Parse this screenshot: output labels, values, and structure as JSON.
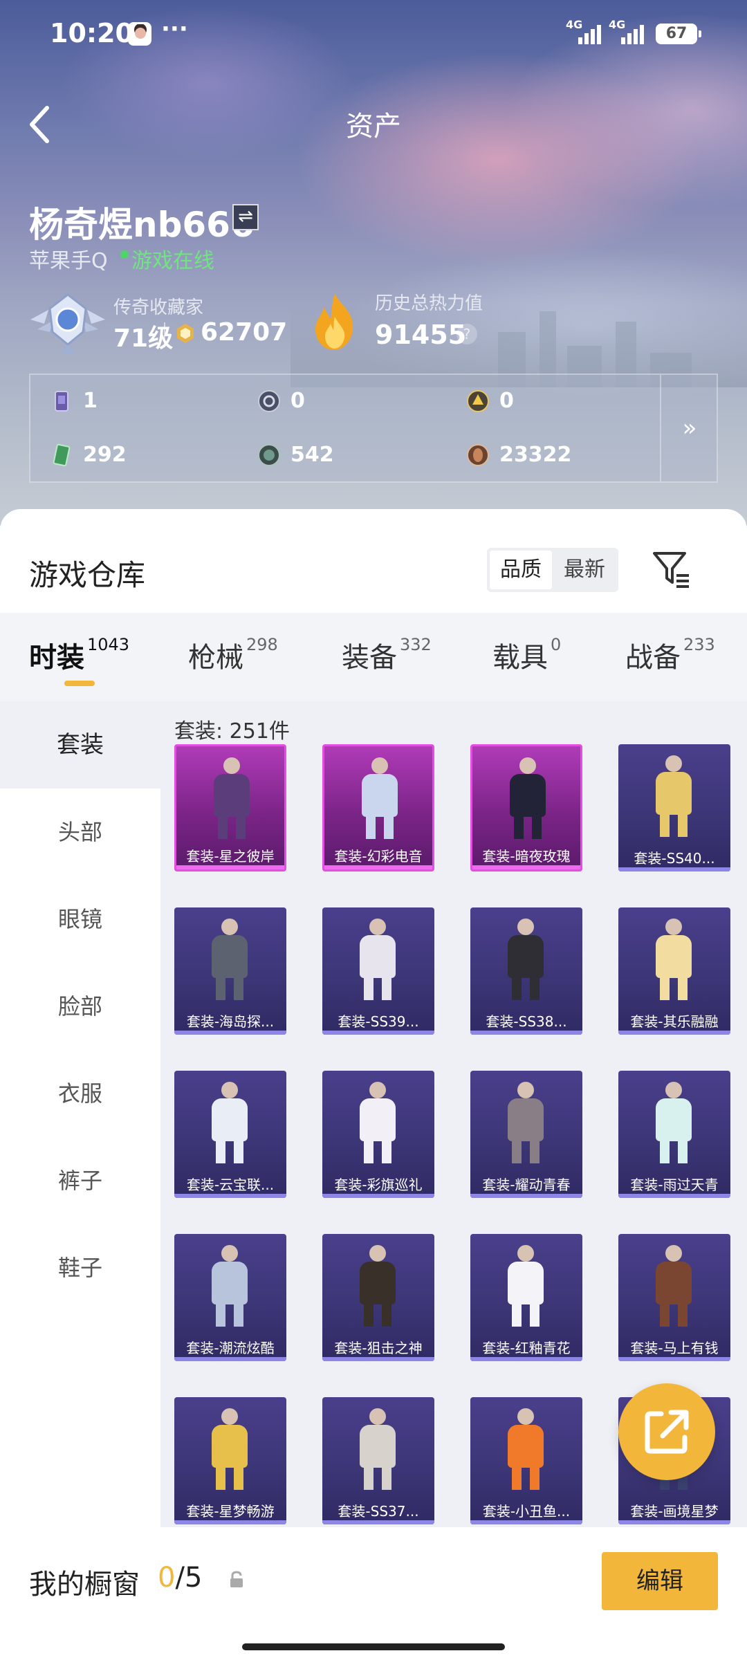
{
  "status_bar": {
    "time": "10:20",
    "dots": "···",
    "net1": "4G",
    "net2": "4G",
    "battery": "67"
  },
  "header": {
    "title": "资产"
  },
  "player": {
    "name": "杨奇煜nb666",
    "platform": "苹果手Q",
    "online": "游戏在线",
    "rank_title": "传奇收藏家",
    "rank_level": "71级",
    "collection_points": "62707",
    "heat_title": "历史总热力值",
    "heat_value": "91455",
    "help": "?"
  },
  "currencies": [
    {
      "icon": "card-icon",
      "value": "1"
    },
    {
      "icon": "silver-token-icon",
      "value": "0"
    },
    {
      "icon": "gold-token-icon",
      "value": "0"
    },
    {
      "icon": "green-ticket-icon",
      "value": "292"
    },
    {
      "icon": "gem-icon",
      "value": "542"
    },
    {
      "icon": "bronze-coin-icon",
      "value": "23322"
    }
  ],
  "currency_more": "»",
  "warehouse": {
    "title": "游戏仓库",
    "sort": [
      "品质",
      "最新"
    ],
    "tabs": [
      {
        "label": "时装",
        "count": "1043"
      },
      {
        "label": "枪械",
        "count": "298"
      },
      {
        "label": "装备",
        "count": "332"
      },
      {
        "label": "载具",
        "count": "0"
      },
      {
        "label": "战备",
        "count": "233"
      }
    ],
    "sidebar": [
      "套装",
      "头部",
      "眼镜",
      "脸部",
      "衣服",
      "裤子",
      "鞋子"
    ],
    "count_label": "套装: 251件",
    "items": [
      {
        "name": "套装-星之彼岸",
        "rarity": "epic",
        "color": "#5a3d7a"
      },
      {
        "name": "套装-幻彩电音",
        "rarity": "epic",
        "color": "#c9d6ee"
      },
      {
        "name": "套装-暗夜玫瑰",
        "rarity": "epic",
        "color": "#232338"
      },
      {
        "name": "套装-SS40...",
        "rarity": "rare",
        "color": "#e6c86a"
      },
      {
        "name": "套装-海岛探...",
        "rarity": "rare",
        "color": "#5c6270"
      },
      {
        "name": "套装-SS39...",
        "rarity": "rare",
        "color": "#e8e4ee"
      },
      {
        "name": "套装-SS38...",
        "rarity": "rare",
        "color": "#2e2e34"
      },
      {
        "name": "套装-其乐融融",
        "rarity": "rare",
        "color": "#f2dca0"
      },
      {
        "name": "套装-云宝联...",
        "rarity": "rare",
        "color": "#e9eef6"
      },
      {
        "name": "套装-彩旗巡礼",
        "rarity": "rare",
        "color": "#f2f0f6"
      },
      {
        "name": "套装-耀动青春",
        "rarity": "rare",
        "color": "#8a7e86"
      },
      {
        "name": "套装-雨过天青",
        "rarity": "rare",
        "color": "#d8f0ee"
      },
      {
        "name": "套装-潮流炫酷",
        "rarity": "rare",
        "color": "#b8c4dc"
      },
      {
        "name": "套装-狙击之神",
        "rarity": "rare",
        "color": "#3a302a"
      },
      {
        "name": "套装-红釉青花",
        "rarity": "rare",
        "color": "#f4f4f8"
      },
      {
        "name": "套装-马上有钱",
        "rarity": "rare",
        "color": "#7a4632"
      },
      {
        "name": "套装-星梦畅游",
        "rarity": "rare",
        "color": "#e6c04a"
      },
      {
        "name": "套装-SS37...",
        "rarity": "rare",
        "color": "#d8d2cc"
      },
      {
        "name": "套装-小丑鱼...",
        "rarity": "rare",
        "color": "#f07a2a"
      },
      {
        "name": "套装-画境星梦",
        "rarity": "rare",
        "color": "#3a4270"
      }
    ]
  },
  "showcase": {
    "label": "我的橱窗",
    "current": "0",
    "sep": "/",
    "max": "5",
    "edit": "编辑"
  }
}
